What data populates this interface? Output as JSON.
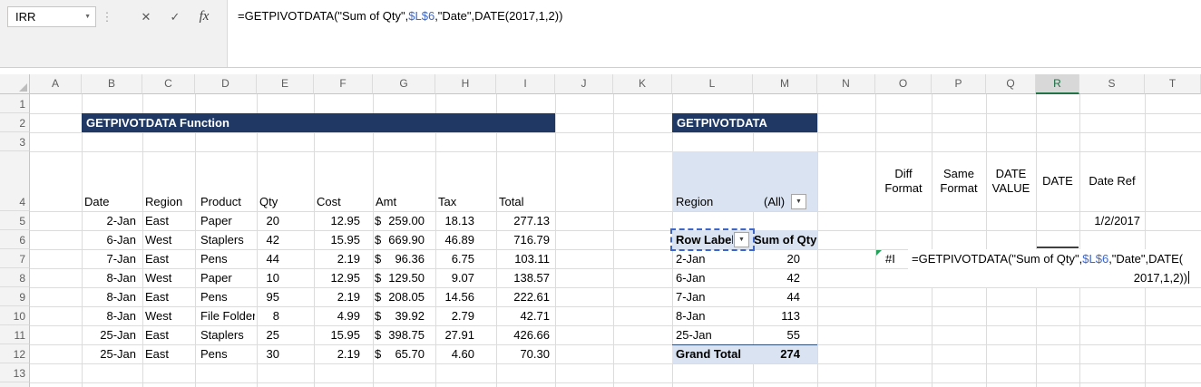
{
  "formula_bar": {
    "name_box": "IRR"
  },
  "icons": {
    "dropdown": "▼",
    "cancel": "✕",
    "enter": "✓",
    "fx": "fx",
    "separator_dots": "⋮"
  },
  "formula": {
    "pre": "=GETPIVOTDATA(\"Sum of Qty\",",
    "ref": "$L$6",
    "mid": ",\"Date\",DATE(",
    "tail": "2017,1,2))"
  },
  "grid": {
    "columns": [
      "A",
      "B",
      "C",
      "D",
      "E",
      "F",
      "G",
      "H",
      "I",
      "J",
      "K",
      "L",
      "M",
      "N",
      "O",
      "P",
      "Q",
      "R",
      "S",
      "T"
    ],
    "rows": [
      "1",
      "2",
      "3",
      "4",
      "5",
      "6",
      "7",
      "8",
      "9",
      "10",
      "11",
      "12",
      "13"
    ],
    "selected_column": "R"
  },
  "left_table": {
    "title": "GETPIVOTDATA Function",
    "headers": [
      "Date",
      "Region",
      "Product",
      "Qty",
      "Cost",
      "Amt",
      "Tax",
      "Total"
    ],
    "currency": "$",
    "rows": [
      {
        "date": "2-Jan",
        "region": "East",
        "product": "Paper",
        "qty": "20",
        "cost": "12.95",
        "amt": "259.00",
        "tax": "18.13",
        "total": "277.13"
      },
      {
        "date": "6-Jan",
        "region": "West",
        "product": "Staplers",
        "qty": "42",
        "cost": "15.95",
        "amt": "669.90",
        "tax": "46.89",
        "total": "716.79"
      },
      {
        "date": "7-Jan",
        "region": "East",
        "product": "Pens",
        "qty": "44",
        "cost": "2.19",
        "amt": "96.36",
        "tax": "6.75",
        "total": "103.11"
      },
      {
        "date": "8-Jan",
        "region": "West",
        "product": "Paper",
        "qty": "10",
        "cost": "12.95",
        "amt": "129.50",
        "tax": "9.07",
        "total": "138.57"
      },
      {
        "date": "8-Jan",
        "region": "East",
        "product": "Pens",
        "qty": "95",
        "cost": "2.19",
        "amt": "208.05",
        "tax": "14.56",
        "total": "222.61"
      },
      {
        "date": "8-Jan",
        "region": "West",
        "product": "File Folders",
        "qty": "8",
        "cost": "4.99",
        "amt": "39.92",
        "tax": "2.79",
        "total": "42.71"
      },
      {
        "date": "25-Jan",
        "region": "East",
        "product": "Staplers",
        "qty": "25",
        "cost": "15.95",
        "amt": "398.75",
        "tax": "27.91",
        "total": "426.66"
      },
      {
        "date": "25-Jan",
        "region": "East",
        "product": "Pens",
        "qty": "30",
        "cost": "2.19",
        "amt": "65.70",
        "tax": "4.60",
        "total": "70.30"
      }
    ]
  },
  "pivot": {
    "title": "GETPIVOTDATA Function",
    "filter_field": "Region",
    "filter_value": "(All)",
    "row_header": "Row Labels",
    "value_header": "Sum of Qty",
    "rows": [
      {
        "label": "2-Jan",
        "value": "20"
      },
      {
        "label": "6-Jan",
        "value": "42"
      },
      {
        "label": "7-Jan",
        "value": "44"
      },
      {
        "label": "8-Jan",
        "value": "113"
      },
      {
        "label": "25-Jan",
        "value": "55"
      }
    ],
    "grand_total_label": "Grand Total",
    "grand_total_value": "274"
  },
  "right_panel": {
    "headers": [
      "Diff Format",
      "Same Format",
      "DATE VALUE",
      "DATE",
      "Date Ref"
    ],
    "date_ref_value": "1/2/2017",
    "error_value": "#I"
  },
  "colors": {
    "title_bar": "#1F3864",
    "pivot_fill": "#DAE3F1",
    "ref_highlight": "#3E66C9",
    "selection_green": "#217346"
  }
}
